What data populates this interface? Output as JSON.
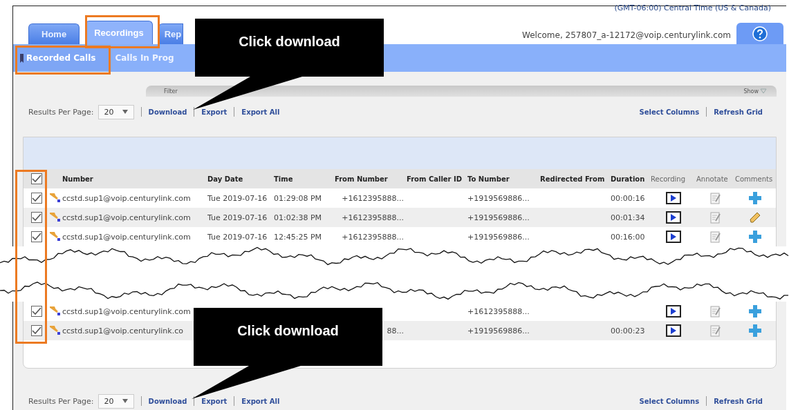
{
  "timezone": "(GMT-06:00) Central Time (US & Canada)",
  "tabs": [
    {
      "label": "Home",
      "selected": false
    },
    {
      "label": "Recordings",
      "selected": true
    },
    {
      "label": "Rep",
      "selected": false
    }
  ],
  "welcome": "Welcome, 257807_a-12172@voip.centurylink.com",
  "subtabs": [
    {
      "label": "Recorded Calls",
      "selected": true
    },
    {
      "label": "Calls In Prog",
      "selected": false
    }
  ],
  "filter": {
    "label": "Filter",
    "toggle": "Show"
  },
  "toolbar_top": {
    "results_label": "Results Per Page:",
    "page_size": "20",
    "actions": [
      "Download",
      "Export",
      "Export All"
    ],
    "right_actions": [
      "Select Columns",
      "Refresh Grid"
    ]
  },
  "table": {
    "header_checked": true,
    "columns": [
      "Number",
      "Day Date",
      "Time",
      "From Number",
      "From Caller ID",
      "To Number",
      "Redirected From",
      "Duration",
      "Recording",
      "Annotate",
      "Comments"
    ],
    "rows": [
      {
        "checked": true,
        "number": "ccstd.sup1@voip.centurylink.com",
        "day_date": "Tue 2019-07-16",
        "time": "01:29:08 PM",
        "from_number": "+1612395888...",
        "to_number": "+1919569886...",
        "duration": "00:00:16",
        "kind": "add"
      },
      {
        "checked": true,
        "number": "ccstd.sup1@voip.centurylink.com",
        "day_date": "Tue 2019-07-16",
        "time": "01:02:38 PM",
        "from_number": "+1612395888...",
        "to_number": "+1919569886...",
        "duration": "00:01:34",
        "kind": "edit"
      },
      {
        "checked": true,
        "number": "ccstd.sup1@voip.centurylink.com",
        "day_date": "Tue 2019-07-16",
        "time": "12:45:25 PM",
        "from_number": "+1612395888...",
        "to_number": "+1919569886...",
        "duration": "00:16:00",
        "kind": "add"
      }
    ],
    "rows_after_tear": [
      {
        "checked": true,
        "number": "ccstd.sup1@voip.centurylink.com",
        "to_number": "+1612395888...",
        "kind": "add"
      },
      {
        "checked": true,
        "number": "ccstd.sup1@voip.centurylink.co",
        "from_number": "88...",
        "to_number": "+1919569886...",
        "duration": "00:00:23",
        "kind": "add"
      }
    ]
  },
  "toolbar_bottom": {
    "results_label": "Results Per Page:",
    "page_size": "20",
    "actions": [
      "Download",
      "Export",
      "Export All"
    ],
    "right_actions": [
      "Select Columns",
      "Refresh Grid"
    ]
  },
  "callouts": [
    {
      "text": "Click download"
    },
    {
      "text": "Click download"
    }
  ]
}
